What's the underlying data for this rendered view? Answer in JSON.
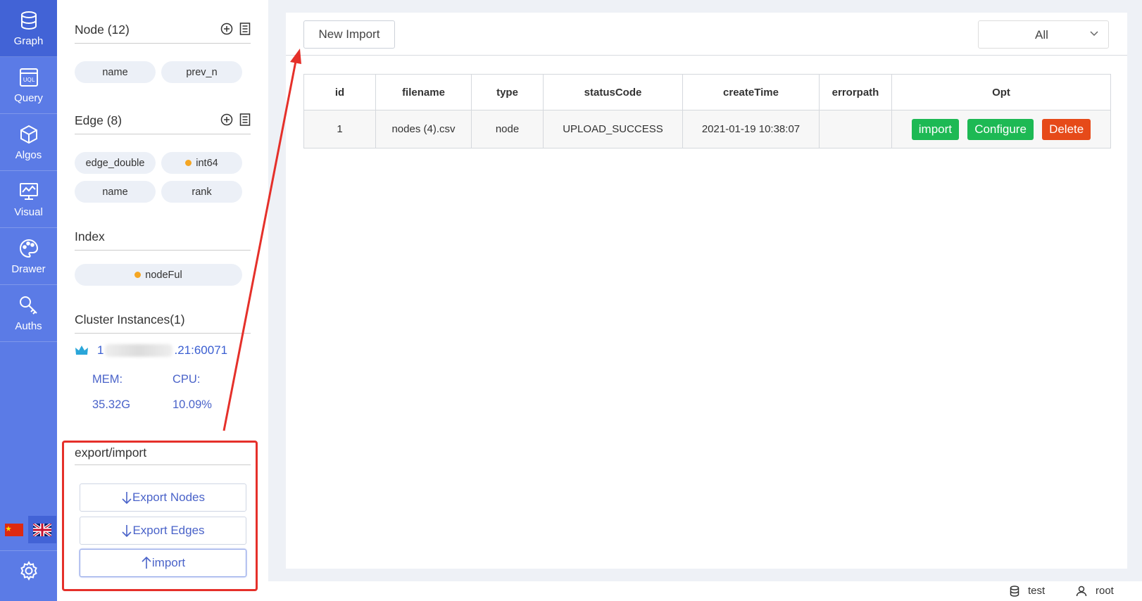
{
  "nav": {
    "items": [
      {
        "label": "Graph",
        "icon": "database-icon"
      },
      {
        "label": "Query",
        "icon": "uql-icon"
      },
      {
        "label": "Algos",
        "icon": "cube-icon"
      },
      {
        "label": "Visual",
        "icon": "monitor-chart-icon"
      },
      {
        "label": "Drawer",
        "icon": "palette-icon"
      },
      {
        "label": "Auths",
        "icon": "key-icon"
      }
    ],
    "languages": [
      "zh",
      "en"
    ],
    "selected_language": "en"
  },
  "panel": {
    "node": {
      "title": "Node (12)",
      "props": [
        "name",
        "prev_n"
      ]
    },
    "edge": {
      "title": "Edge (8)",
      "props": [
        "edge_double",
        "int64",
        "name",
        "rank"
      ]
    },
    "index": {
      "title": "Index",
      "items": [
        "nodeFul"
      ]
    },
    "cluster": {
      "title": "Cluster Instances(1)",
      "host_prefix": "1",
      "host_suffix": ".21:60071",
      "mem_label": "MEM:",
      "cpu_label": "CPU:",
      "mem_value": "35.32G",
      "cpu_value": "10.09%"
    },
    "export": {
      "title": "export/import",
      "export_nodes": "Export Nodes",
      "export_edges": "Export Edges",
      "import": "import"
    }
  },
  "main": {
    "new_import": "New Import",
    "filter_value": "All",
    "table": {
      "headers": [
        "id",
        "filename",
        "type",
        "statusCode",
        "createTime",
        "errorpath",
        "Opt"
      ],
      "rows": [
        {
          "id": "1",
          "filename": "nodes (4).csv",
          "type": "node",
          "statusCode": "UPLOAD_SUCCESS",
          "createTime": "2021-01-19 10:38:07",
          "errorpath": ""
        }
      ],
      "actions": {
        "import": "import",
        "configure": "Configure",
        "delete": "Delete"
      }
    }
  },
  "status": {
    "database": "test",
    "user": "root"
  },
  "colors": {
    "nav_bg": "#5b7be6",
    "nav_active": "#4263d6",
    "green": "#1db954",
    "red": "#e64a19",
    "annotation": "#e5302a"
  }
}
